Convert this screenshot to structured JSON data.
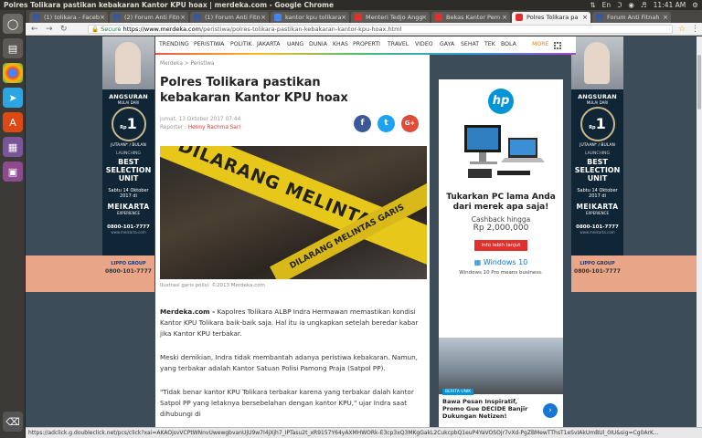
{
  "os": {
    "window_title": "Polres Tolikara pastikan kebakaran Kantor KPU hoax | merdeka.com - Google Chrome",
    "time": "11:41 AM"
  },
  "tabs": [
    {
      "label": "(1) tolikara - Faceb",
      "favicon_color": "#3b5998",
      "active": false
    },
    {
      "label": "(2) Forum Anti Fitn",
      "favicon_color": "#3b5998",
      "active": false
    },
    {
      "label": "(1) Forum Anti Fitn",
      "favicon_color": "#3b5998",
      "active": false
    },
    {
      "label": "kantor kpu tolikara",
      "favicon_color": "#4285f4",
      "active": false
    },
    {
      "label": "Menteri Tedjo Angg",
      "favicon_color": "#e2312d",
      "active": false
    },
    {
      "label": "Bekas Kantor Pem",
      "favicon_color": "#e2312d",
      "active": false
    },
    {
      "label": "Polres Tolikara pa",
      "favicon_color": "#e2312d",
      "active": true
    },
    {
      "label": "Forum Anti Fitnah",
      "favicon_color": "#3b5998",
      "active": false
    }
  ],
  "address": {
    "secure_label": "Secure",
    "url_host": "https://www.merdeka.com",
    "url_path": "/peristiwa/polres-tolikara-pastikan-kebakaran-kantor-kpu-hoax.html"
  },
  "nav": [
    "TRENDING",
    "PERISTIWA",
    "POLITIK",
    "JAKARTA",
    "UANG",
    "DUNIA",
    "KHAS",
    "PROPERTI",
    "TRAVEL",
    "VIDEO",
    "GAYA",
    "SEHAT",
    "TEK",
    "BOLA"
  ],
  "nav_more": "MORE",
  "article": {
    "breadcrumb": "Merdeka > Peristiwa",
    "headline": "Polres Tolikara pastikan kebakaran Kantor KPU hoax",
    "date": "Jumat, 13 Oktober 2017 07:44",
    "reporter_label": "Reporter :",
    "reporter_name": "Henny Rachma Sari",
    "photo_tape_text": "DILARANG MELINTAS",
    "photo_tape_text2": "DILARANG MELINTAS GARIS",
    "caption": "Ilustrasi garis polisi. ©2013 Merdeka.com",
    "p1_lead": "Merdeka.com -",
    "p1": "Kapolres Tolikara ALBP Indra Hermawan memastikan kondisi Kantor KPU Tolikara baik-baik saja. Hal itu ia ungkapkan setelah beredar kabar jika Kantor KPU terbakar.",
    "p2": "Meski demikian, Indra tidak membantah adanya peristiwa kebakaran. Namun, yang terbakar adalah Kantor Satuan Polisi Pamong Praja (Satpol PP).",
    "p3": "\"Tidak benar kantor KPU Tolikara terbakar karena yang terbakar dalah kantor Satpol PP yang letaknya bersebelahan dengan kantor KPU,\" ujar Indra saat dihubungi di"
  },
  "social": {
    "facebook": "f",
    "twitter": "t",
    "google": "G+"
  },
  "side_ad": {
    "t1": "ANGSURAN",
    "t1b": "MULAI DARI",
    "circle_pre": "Rp",
    "circle": "1",
    "circle_post": "JUTAAN* / BULAN",
    "t4": "LAUNCHING",
    "t5": "BEST SELECTION UNIT",
    "date": "Sabtu 14 Oktober 2017 di",
    "brand": "MEIKARTA",
    "brand_sub": "EXPERIENCE",
    "phone": "0800-101-7777",
    "web": "www.meikarta.com",
    "lippo": "LIPPO GROUP"
  },
  "hp_ad": {
    "logo": "hp",
    "h1": "Tukarkan PC lama Anda dari merek apa saja!",
    "h2": "Cashback hingga",
    "price": "Rp 2,000,000",
    "cta": "Info lebih lanjut",
    "win": "Windows 10",
    "win_sub": "Windows 10 Pro means business."
  },
  "news": {
    "tag": "BERITA UNIK",
    "title": "Bawa Pesan Inspiratif, Promo Gue DECIDE Banjir Dukungan Netizen!"
  },
  "status_url": "https://adclick.g.doubleclick.net/pcs/click?xai=AKAOjsvVCPtWNnvUwewgbvanUjU9w7I4jXjh7_IPTasu2t_xR9157Y64yAXMHWORk-E3cp3xQ3MKgGakL2CukcpbQ1euP4YaVOSOjr7vXd-PgZBMewTThsT1eSvIAkUmBUl_0IU&sig=Cg0ArK..."
}
